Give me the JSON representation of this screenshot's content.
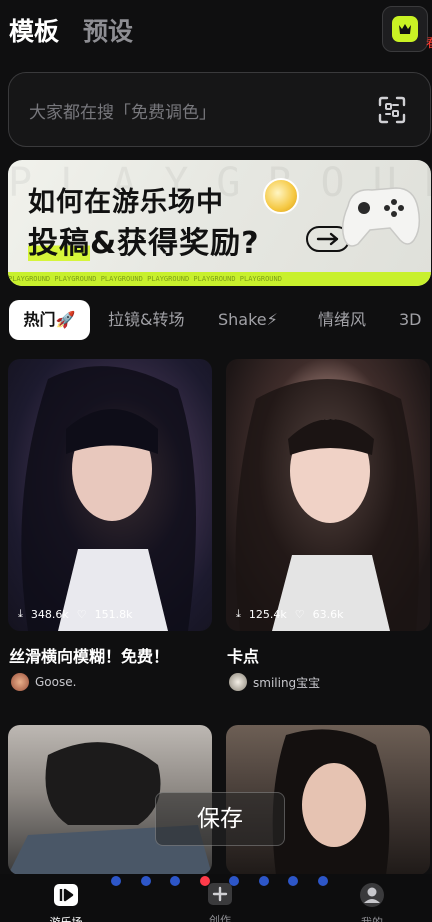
{
  "header": {
    "tab_active": "模板",
    "tab_inactive": "预设",
    "edge_glyph": "看"
  },
  "search": {
    "placeholder": "大家都在搜「免费调色」"
  },
  "banner": {
    "line1": "如何在游乐场中",
    "line2_a": "投稿",
    "line2_b": "&获得奖励?",
    "bg_letters": "PLAYGROUND",
    "strip_text": "PLAYGROUND    PLAYGROUND    PLAYGROUND    PLAYGROUND    PLAYGROUND    PLAYGROUND"
  },
  "categories": [
    {
      "label": "热门🚀"
    },
    {
      "label": "拉镜&转场"
    },
    {
      "label": "Shake⚡"
    },
    {
      "label": "情绪风"
    },
    {
      "label": "3D"
    }
  ],
  "cards": [
    {
      "downloads": "348.6k",
      "likes": "151.8k",
      "title": "丝滑横向模糊！免费！",
      "author": "Goose."
    },
    {
      "downloads": "125.4k",
      "likes": "63.6k",
      "title": "卡点",
      "author": "smiling宝宝"
    }
  ],
  "overlay": {
    "save_label": "保存"
  },
  "bottom_nav": {
    "items": [
      {
        "label": "游乐场",
        "icon": "playground-icon"
      },
      {
        "label": "创作",
        "icon": "create-icon"
      },
      {
        "label": "我的",
        "icon": "profile-icon"
      }
    ],
    "active_dot_index": 3,
    "dot_count": 8
  },
  "colors": {
    "accent": "#c9f224",
    "background": "#0f0f10",
    "dot_blue": "#2d56c8",
    "dot_red": "#ff3b4a"
  }
}
